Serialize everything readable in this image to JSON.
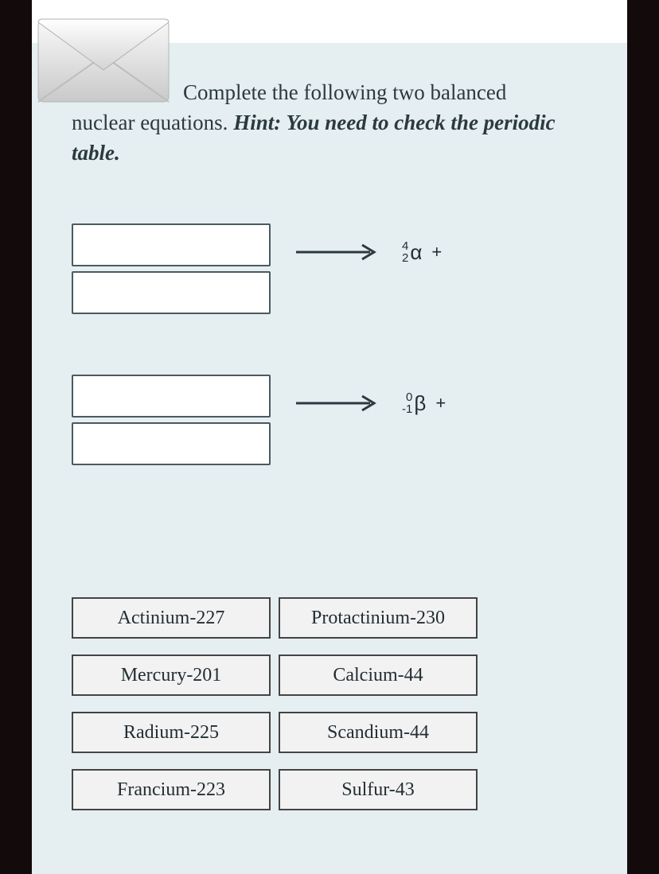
{
  "prompt": {
    "line1": "Complete the following two balanced",
    "line2_plain": "nuclear equations. ",
    "hint": "Hint: You need to check the periodic table."
  },
  "equations": [
    {
      "particle": {
        "top": "4",
        "bottom": "2",
        "symbol": "α"
      },
      "plus": "+"
    },
    {
      "particle": {
        "top": "0",
        "bottom": "-1",
        "symbol": "β"
      },
      "plus": "+"
    }
  ],
  "answers": [
    "Actinium-227",
    "Protactinium-230",
    "Mercury-201",
    "Calcium-44",
    "Radium-225",
    "Scandium-44",
    "Francium-223",
    "Sulfur-43"
  ]
}
